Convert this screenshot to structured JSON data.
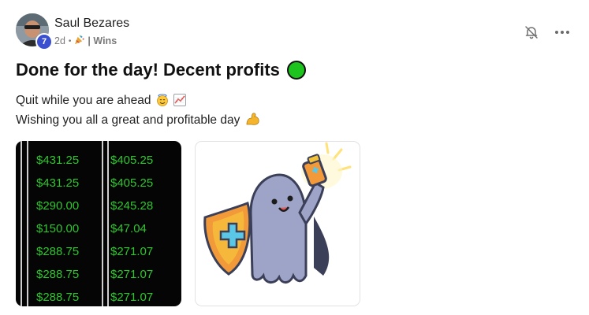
{
  "post": {
    "author": {
      "name": "Saul Bezares",
      "level": "7"
    },
    "meta": {
      "time": "2d",
      "separator": "•",
      "category": "| Wins"
    },
    "title": "Done for the day! Decent profits",
    "body": {
      "line1": "Quit while you are ahead",
      "line2": "Wishing you all a great and profitable day"
    },
    "attachment_1": {
      "col1": [
        "$431.25",
        "$431.25",
        "$290.00",
        "$150.00",
        "$288.75",
        "$288.75",
        "$288.75"
      ],
      "col2": [
        "$405.25",
        "$405.25",
        "$245.28",
        "$47.04",
        "$271.07",
        "$271.07",
        "$271.07"
      ],
      "text_color": "#2fc52f"
    },
    "colors": {
      "status_dot": "#1dc41d",
      "level_badge": "#3a4fcf"
    },
    "icons": {
      "bell": "bell-muted-icon",
      "more": "more-horizontal-icon",
      "party": "party-popper-icon",
      "smile": "smiling-halo-face-icon",
      "chart": "chart-increasing-icon",
      "muscle": "flexed-biceps-icon"
    }
  }
}
